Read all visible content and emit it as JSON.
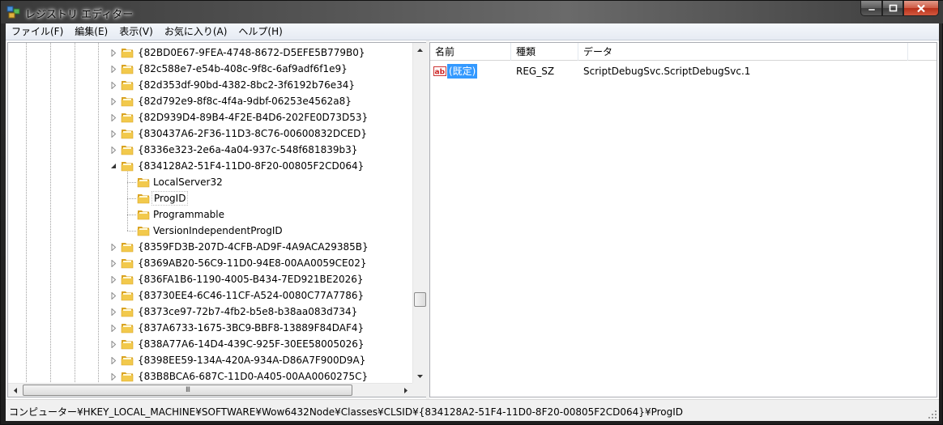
{
  "window": {
    "title": "レジストリ エディター"
  },
  "menu": [
    "ファイル(F)",
    "編集(E)",
    "表示(V)",
    "お気に入り(A)",
    "ヘルプ(H)"
  ],
  "tree": {
    "items": [
      {
        "label": "{82BD0E67-9FEA-4748-8672-D5EFE5B779B0}",
        "level": 1,
        "state": "collapsed"
      },
      {
        "label": "{82c588e7-e54b-408c-9f8c-6af9adf6f1e9}",
        "level": 1,
        "state": "collapsed"
      },
      {
        "label": "{82d353df-90bd-4382-8bc2-3f6192b76e34}",
        "level": 1,
        "state": "collapsed"
      },
      {
        "label": "{82d792e9-8f8c-4f4a-9dbf-06253e4562a8}",
        "level": 1,
        "state": "collapsed"
      },
      {
        "label": "{82D939D4-89B4-4F2E-B4D6-202FE0D73D53}",
        "level": 1,
        "state": "collapsed"
      },
      {
        "label": "{830437A6-2F36-11D3-8C76-00600832DCED}",
        "level": 1,
        "state": "collapsed"
      },
      {
        "label": "{8336e323-2e6a-4a04-937c-548f681839b3}",
        "level": 1,
        "state": "collapsed"
      },
      {
        "label": "{834128A2-51F4-11D0-8F20-00805F2CD064}",
        "level": 1,
        "state": "expanded"
      },
      {
        "label": "LocalServer32",
        "level": 2,
        "state": "leaf"
      },
      {
        "label": "ProgID",
        "level": 2,
        "state": "leaf",
        "selected": true
      },
      {
        "label": "Programmable",
        "level": 2,
        "state": "leaf"
      },
      {
        "label": "VersionIndependentProgID",
        "level": 2,
        "state": "leaf",
        "last": true
      },
      {
        "label": "{8359FD3B-207D-4CFB-AD9F-4A9ACA29385B}",
        "level": 1,
        "state": "collapsed"
      },
      {
        "label": "{8369AB20-56C9-11D0-94E8-00AA0059CE02}",
        "level": 1,
        "state": "collapsed"
      },
      {
        "label": "{836FA1B6-1190-4005-B434-7ED921BE2026}",
        "level": 1,
        "state": "collapsed"
      },
      {
        "label": "{83730EE4-6C46-11CF-A524-0080C77A7786}",
        "level": 1,
        "state": "collapsed"
      },
      {
        "label": "{8373ce97-72b7-4fb2-b5e8-b38aa083d734}",
        "level": 1,
        "state": "collapsed"
      },
      {
        "label": "{837A6733-1675-3BC9-BBF8-13889F84DAF4}",
        "level": 1,
        "state": "collapsed"
      },
      {
        "label": "{838A77A6-14D4-439C-925F-30EE58005026}",
        "level": 1,
        "state": "collapsed"
      },
      {
        "label": "{8398EE59-134A-420A-934A-D86A7F900D9A}",
        "level": 1,
        "state": "collapsed"
      },
      {
        "label": "{83B8BCA6-687C-11D0-A405-00AA0060275C}",
        "level": 1,
        "state": "collapsed"
      }
    ],
    "hscroll_grip": "III"
  },
  "list": {
    "columns": [
      "名前",
      "種類",
      "データ"
    ],
    "rows": [
      {
        "name": "(既定)",
        "type": "REG_SZ",
        "data": "ScriptDebugSvc.ScriptDebugSvc.1",
        "icon": "string-value-icon",
        "selected": true
      }
    ]
  },
  "status": {
    "path": "コンピューター¥HKEY_LOCAL_MACHINE¥SOFTWARE¥Wow6432Node¥Classes¥CLSID¥{834128A2-51F4-11D0-8F20-00805F2CD064}¥ProgID"
  },
  "colors": {
    "selection": "#3399ff",
    "folder": "#f2c94c",
    "folder_dark": "#d9a322"
  }
}
